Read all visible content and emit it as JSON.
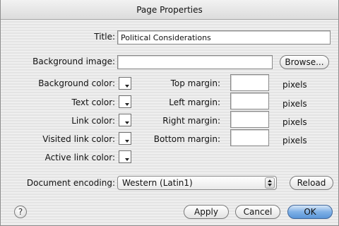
{
  "window": {
    "title": "Page Properties"
  },
  "fields": {
    "title_label": "Title:",
    "title_value": "Political Considerations",
    "background_image_label": "Background image:",
    "background_image_value": "",
    "browse_label": "Browse..."
  },
  "colors": {
    "background_label": "Background color:",
    "text_label": "Text color:",
    "link_label": "Link color:",
    "visited_label": "Visited link color:",
    "active_label": "Active link color:"
  },
  "margins": {
    "top_label": "Top margin:",
    "left_label": "Left margin:",
    "right_label": "Right margin:",
    "bottom_label": "Bottom margin:",
    "unit": "pixels",
    "top_value": "",
    "left_value": "",
    "right_value": "",
    "bottom_value": ""
  },
  "encoding": {
    "label": "Document encoding:",
    "selected": "Western (Latin1)",
    "reload_label": "Reload"
  },
  "footer": {
    "help_glyph": "?",
    "apply_label": "Apply",
    "cancel_label": "Cancel",
    "ok_label": "OK"
  },
  "icons": {
    "help": "question-icon",
    "swatch_arrow": "triangle-down-icon",
    "popup_stepper": "up-down-arrows-icon"
  }
}
